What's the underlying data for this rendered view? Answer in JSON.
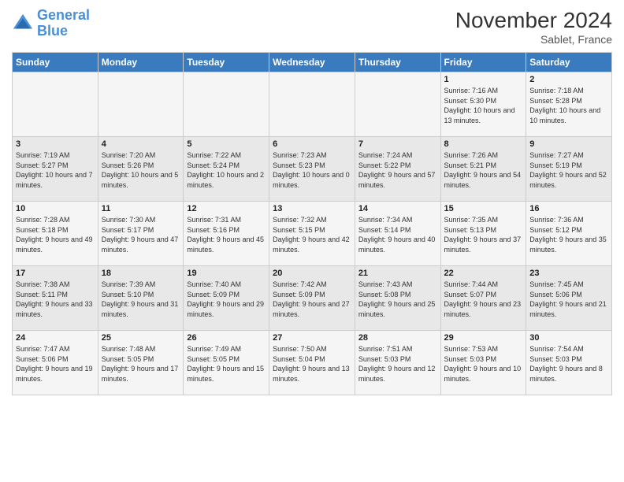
{
  "header": {
    "logo_line1": "General",
    "logo_line2": "Blue",
    "month_year": "November 2024",
    "location": "Sablet, France"
  },
  "days_of_week": [
    "Sunday",
    "Monday",
    "Tuesday",
    "Wednesday",
    "Thursday",
    "Friday",
    "Saturday"
  ],
  "weeks": [
    [
      {
        "day": "",
        "info": ""
      },
      {
        "day": "",
        "info": ""
      },
      {
        "day": "",
        "info": ""
      },
      {
        "day": "",
        "info": ""
      },
      {
        "day": "",
        "info": ""
      },
      {
        "day": "1",
        "info": "Sunrise: 7:16 AM\nSunset: 5:30 PM\nDaylight: 10 hours and 13 minutes."
      },
      {
        "day": "2",
        "info": "Sunrise: 7:18 AM\nSunset: 5:28 PM\nDaylight: 10 hours and 10 minutes."
      }
    ],
    [
      {
        "day": "3",
        "info": "Sunrise: 7:19 AM\nSunset: 5:27 PM\nDaylight: 10 hours and 7 minutes."
      },
      {
        "day": "4",
        "info": "Sunrise: 7:20 AM\nSunset: 5:26 PM\nDaylight: 10 hours and 5 minutes."
      },
      {
        "day": "5",
        "info": "Sunrise: 7:22 AM\nSunset: 5:24 PM\nDaylight: 10 hours and 2 minutes."
      },
      {
        "day": "6",
        "info": "Sunrise: 7:23 AM\nSunset: 5:23 PM\nDaylight: 10 hours and 0 minutes."
      },
      {
        "day": "7",
        "info": "Sunrise: 7:24 AM\nSunset: 5:22 PM\nDaylight: 9 hours and 57 minutes."
      },
      {
        "day": "8",
        "info": "Sunrise: 7:26 AM\nSunset: 5:21 PM\nDaylight: 9 hours and 54 minutes."
      },
      {
        "day": "9",
        "info": "Sunrise: 7:27 AM\nSunset: 5:19 PM\nDaylight: 9 hours and 52 minutes."
      }
    ],
    [
      {
        "day": "10",
        "info": "Sunrise: 7:28 AM\nSunset: 5:18 PM\nDaylight: 9 hours and 49 minutes."
      },
      {
        "day": "11",
        "info": "Sunrise: 7:30 AM\nSunset: 5:17 PM\nDaylight: 9 hours and 47 minutes."
      },
      {
        "day": "12",
        "info": "Sunrise: 7:31 AM\nSunset: 5:16 PM\nDaylight: 9 hours and 45 minutes."
      },
      {
        "day": "13",
        "info": "Sunrise: 7:32 AM\nSunset: 5:15 PM\nDaylight: 9 hours and 42 minutes."
      },
      {
        "day": "14",
        "info": "Sunrise: 7:34 AM\nSunset: 5:14 PM\nDaylight: 9 hours and 40 minutes."
      },
      {
        "day": "15",
        "info": "Sunrise: 7:35 AM\nSunset: 5:13 PM\nDaylight: 9 hours and 37 minutes."
      },
      {
        "day": "16",
        "info": "Sunrise: 7:36 AM\nSunset: 5:12 PM\nDaylight: 9 hours and 35 minutes."
      }
    ],
    [
      {
        "day": "17",
        "info": "Sunrise: 7:38 AM\nSunset: 5:11 PM\nDaylight: 9 hours and 33 minutes."
      },
      {
        "day": "18",
        "info": "Sunrise: 7:39 AM\nSunset: 5:10 PM\nDaylight: 9 hours and 31 minutes."
      },
      {
        "day": "19",
        "info": "Sunrise: 7:40 AM\nSunset: 5:09 PM\nDaylight: 9 hours and 29 minutes."
      },
      {
        "day": "20",
        "info": "Sunrise: 7:42 AM\nSunset: 5:09 PM\nDaylight: 9 hours and 27 minutes."
      },
      {
        "day": "21",
        "info": "Sunrise: 7:43 AM\nSunset: 5:08 PM\nDaylight: 9 hours and 25 minutes."
      },
      {
        "day": "22",
        "info": "Sunrise: 7:44 AM\nSunset: 5:07 PM\nDaylight: 9 hours and 23 minutes."
      },
      {
        "day": "23",
        "info": "Sunrise: 7:45 AM\nSunset: 5:06 PM\nDaylight: 9 hours and 21 minutes."
      }
    ],
    [
      {
        "day": "24",
        "info": "Sunrise: 7:47 AM\nSunset: 5:06 PM\nDaylight: 9 hours and 19 minutes."
      },
      {
        "day": "25",
        "info": "Sunrise: 7:48 AM\nSunset: 5:05 PM\nDaylight: 9 hours and 17 minutes."
      },
      {
        "day": "26",
        "info": "Sunrise: 7:49 AM\nSunset: 5:05 PM\nDaylight: 9 hours and 15 minutes."
      },
      {
        "day": "27",
        "info": "Sunrise: 7:50 AM\nSunset: 5:04 PM\nDaylight: 9 hours and 13 minutes."
      },
      {
        "day": "28",
        "info": "Sunrise: 7:51 AM\nSunset: 5:03 PM\nDaylight: 9 hours and 12 minutes."
      },
      {
        "day": "29",
        "info": "Sunrise: 7:53 AM\nSunset: 5:03 PM\nDaylight: 9 hours and 10 minutes."
      },
      {
        "day": "30",
        "info": "Sunrise: 7:54 AM\nSunset: 5:03 PM\nDaylight: 9 hours and 8 minutes."
      }
    ]
  ]
}
